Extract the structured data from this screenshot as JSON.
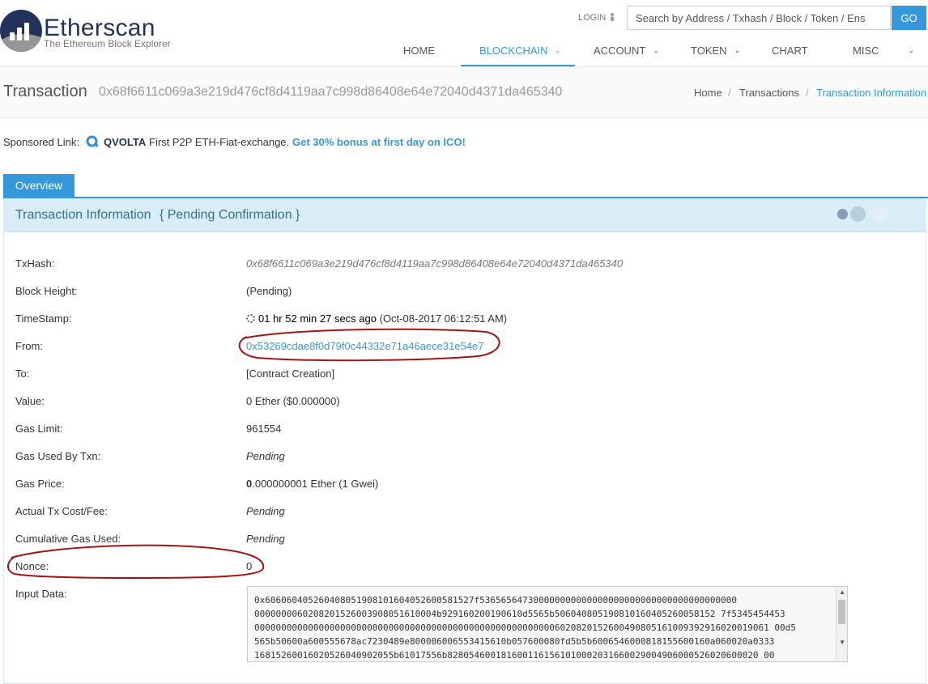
{
  "header": {
    "logo_title": "Etherscan",
    "logo_subtitle": "The Ethereum Block Explorer",
    "login_label": "LOGIN",
    "search_placeholder": "Search by Address / Txhash / Block / Token / Ens",
    "go_label": "GO",
    "nav": [
      {
        "label": "HOME",
        "has_dropdown": false,
        "active": false
      },
      {
        "label": "BLOCKCHAIN",
        "has_dropdown": true,
        "active": true
      },
      {
        "label": "ACCOUNT",
        "has_dropdown": true,
        "active": false
      },
      {
        "label": "TOKEN",
        "has_dropdown": true,
        "active": false
      },
      {
        "label": "CHART",
        "has_dropdown": false,
        "active": false
      },
      {
        "label": "MISC",
        "has_dropdown": true,
        "active": false
      }
    ]
  },
  "page": {
    "title": "Transaction",
    "tx_hash": "0x68f6611c069a3e219d476cf8d4119aa7c998d86408e64e72040d4371da465340",
    "breadcrumb": [
      "Home",
      "Transactions",
      "Transaction Information"
    ],
    "breadcrumb_sep": "/"
  },
  "sponsored": {
    "label": "Sponsored Link:",
    "brand": "QVOLTA",
    "text": "First P2P ETH-Fiat-exchange.",
    "link": "Get 30% bonus at first day on ICO!"
  },
  "tabs": {
    "overview": "Overview"
  },
  "panel": {
    "title": "Transaction Information",
    "status": "{ Pending Confirmation }"
  },
  "rows": {
    "txhash": {
      "label": "TxHash:",
      "value": "0x68f6611c069a3e219d476cf8d4119aa7c998d86408e64e72040d4371da465340"
    },
    "block_height": {
      "label": "Block Height:",
      "value": "(Pending)"
    },
    "timestamp": {
      "label": "TimeStamp:",
      "value_bold": "01 hr 52 min 27 secs ago",
      "value_rest": "(Oct-08-2017 06:12:51 AM)"
    },
    "from": {
      "label": "From:",
      "value": "0x53269cdae8f0d79f0c44332e71a46aece31e54e7"
    },
    "to": {
      "label": "To:",
      "value": "[Contract Creation]"
    },
    "value": {
      "label": "Value:",
      "value": "0 Ether ($0.000000)"
    },
    "gas_limit": {
      "label": "Gas Limit:",
      "value": "961554"
    },
    "gas_used": {
      "label": "Gas Used By Txn:",
      "value": "Pending"
    },
    "gas_price": {
      "label": "Gas Price:",
      "value_bold": "0",
      "value_rest": ".000000001 Ether (1 Gwei)"
    },
    "tx_cost": {
      "label": "Actual Tx Cost/Fee:",
      "value": "Pending"
    },
    "cumulative_gas": {
      "label": "Cumulative Gas Used:",
      "value": "Pending"
    },
    "nonce": {
      "label": "Nonce:",
      "value": "0"
    },
    "input_data": {
      "label": "Input Data:",
      "value": "0x6060604052604080519081016040526005815..."
    }
  },
  "input_data_lines": [
    "0x606060405260408051908101604052600581527f536565647300000000000000000000000000000000000000",
    "0000000060208201526003908051610004b929160200190610d5565b506040805190810160405260058152 7f5345454453",
    "000000000000000000000000000000000000000000000000000000006020820152600490805161009392916020019061 00d5",
    "565b50600a600555678ac7230489e800006006553415610b057600080fd5b5b6006546000818155600160a060020a0333",
    "16815260016020526040902055b61017556b8280546001816001161561010002031660029004906000526020600020 00"
  ],
  "colors": {
    "accent": "#3498db",
    "brand": "#21325b",
    "panel_head": "#d9edf7",
    "annotation": "#a31515"
  }
}
